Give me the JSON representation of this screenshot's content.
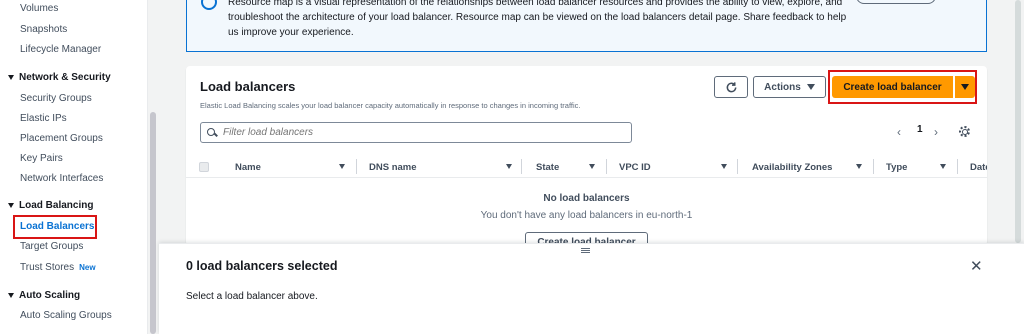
{
  "sidebar": {
    "top_links": [
      "Volumes",
      "Snapshots",
      "Lifecycle Manager"
    ],
    "network_security": {
      "title": "Network & Security",
      "items": [
        "Security Groups",
        "Elastic IPs",
        "Placement Groups",
        "Key Pairs",
        "Network Interfaces"
      ]
    },
    "load_balancing": {
      "title": "Load Balancing",
      "items": [
        "Load Balancers",
        "Target Groups",
        "Trust Stores"
      ],
      "new_badge": "New"
    },
    "auto_scaling": {
      "title": "Auto Scaling",
      "items": [
        "Auto Scaling Groups"
      ]
    }
  },
  "banner": {
    "text": "Resource map is a visual representation of the relationships between load balancer resources and provides the ability to view, explore, and troubleshoot the architecture of your load balancer. Resource map can be viewed on the load balancers detail page. Share feedback to help us improve your experience."
  },
  "panel": {
    "title": "Load balancers",
    "description": "Elastic Load Balancing scales your load balancer capacity automatically in response to changes in incoming traffic.",
    "actions_label": "Actions",
    "create_label": "Create load balancer",
    "search_placeholder": "Filter load balancers",
    "page_number": "1",
    "columns": [
      "Name",
      "DNS name",
      "State",
      "VPC ID",
      "Availability Zones",
      "Type",
      "Date"
    ],
    "empty_title": "No load balancers",
    "empty_subtitle": "You don't have any load balancers in eu-north-1",
    "empty_button": "Create load balancer"
  },
  "split_panel": {
    "title": "0 load balancers selected",
    "text": "Select a load balancer above."
  },
  "colors": {
    "accent": "#0972d3",
    "primary_button": "#ff9900",
    "highlight": "#d91515"
  },
  "icons": [
    "info-icon",
    "refresh-icon",
    "search-icon",
    "settings-icon",
    "close-icon",
    "drag-handle-icon"
  ]
}
